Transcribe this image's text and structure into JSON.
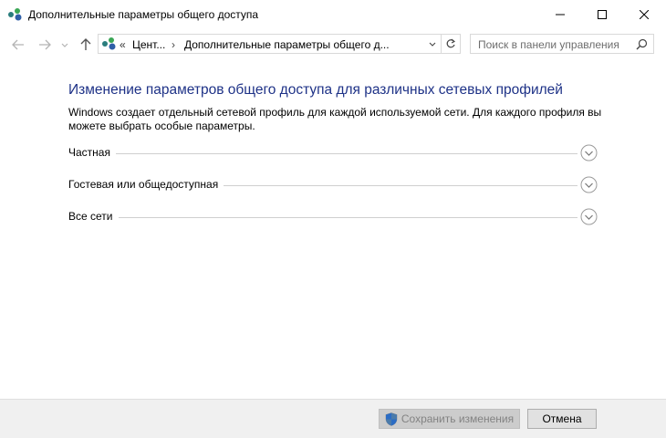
{
  "window": {
    "title": "Дополнительные параметры общего доступа",
    "icon": "network-icon",
    "controls": [
      "minimize-icon",
      "maximize-icon",
      "close-icon"
    ]
  },
  "nav": {
    "back_icon": "back-arrow-icon",
    "forward_icon": "forward-arrow-icon",
    "recent_icon": "chevron-down-icon",
    "up_icon": "up-arrow-icon"
  },
  "address": {
    "overflow": "«",
    "crumbs": [
      "Цент...",
      "Дополнительные параметры общего д..."
    ],
    "separator": "›",
    "dropdown_icon": "chevron-down-icon",
    "refresh_icon": "refresh-icon"
  },
  "search": {
    "placeholder": "Поиск в панели управления",
    "icon": "search-icon"
  },
  "main": {
    "heading": "Изменение параметров общего доступа для различных сетевых профилей",
    "description": "Windows создает отдельный сетевой профиль для каждой используемой сети. Для каждого профиля вы можете выбрать особые параметры.",
    "sections": [
      {
        "label": "Частная",
        "expanded": false
      },
      {
        "label": "Гостевая или общедоступная",
        "expanded": false
      },
      {
        "label": "Все сети",
        "expanded": false
      }
    ]
  },
  "footer": {
    "save_label": "Сохранить изменения",
    "save_enabled": false,
    "cancel_label": "Отмена",
    "save_icon": "uac-shield-icon"
  },
  "colors": {
    "heading": "#1e3287",
    "footer_bg": "#f0f0f0",
    "divider": "#cfcfcf"
  }
}
